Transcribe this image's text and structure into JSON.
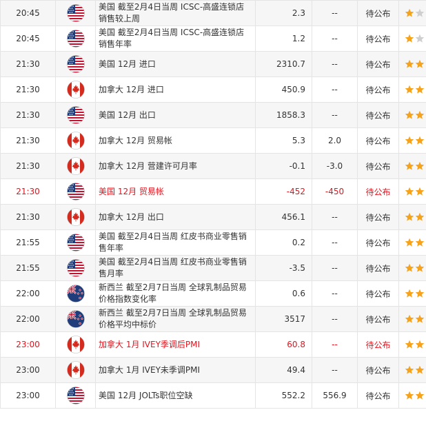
{
  "colors": {
    "highlight": "#e0141e",
    "star_on": "#f7a21b",
    "star_off": "#cfcfcf"
  },
  "rows": [
    {
      "time": "20:45",
      "country": "us",
      "event": "美国 截至2月4日当周 ICSC-高盛连锁店销售较上周",
      "previous": "2.3",
      "forecast": "--",
      "actual": "待公布",
      "stars": 1,
      "highlight": false
    },
    {
      "time": "20:45",
      "country": "us",
      "event": "美国 截至2月4日当周 ICSC-高盛连锁店销售年率",
      "previous": "1.2",
      "forecast": "--",
      "actual": "待公布",
      "stars": 1,
      "highlight": false
    },
    {
      "time": "21:30",
      "country": "us",
      "event": "美国 12月 进口",
      "previous": "2310.7",
      "forecast": "--",
      "actual": "待公布",
      "stars": 2,
      "highlight": false
    },
    {
      "time": "21:30",
      "country": "ca",
      "event": "加拿大 12月 进口",
      "previous": "450.9",
      "forecast": "--",
      "actual": "待公布",
      "stars": 2,
      "highlight": false
    },
    {
      "time": "21:30",
      "country": "us",
      "event": "美国 12月 出口",
      "previous": "1858.3",
      "forecast": "--",
      "actual": "待公布",
      "stars": 2,
      "highlight": false
    },
    {
      "time": "21:30",
      "country": "ca",
      "event": "加拿大 12月 贸易帐",
      "previous": "5.3",
      "forecast": "2.0",
      "actual": "待公布",
      "stars": 2,
      "highlight": false
    },
    {
      "time": "21:30",
      "country": "ca",
      "event": "加拿大 12月 营建许可月率",
      "previous": "-0.1",
      "forecast": "-3.0",
      "actual": "待公布",
      "stars": 2,
      "highlight": false
    },
    {
      "time": "21:30",
      "country": "us",
      "event": "美国 12月 贸易帐",
      "previous": "-452",
      "forecast": "-450",
      "actual": "待公布",
      "stars": 3,
      "highlight": true
    },
    {
      "time": "21:30",
      "country": "ca",
      "event": "加拿大 12月 出口",
      "previous": "456.1",
      "forecast": "--",
      "actual": "待公布",
      "stars": 2,
      "highlight": false
    },
    {
      "time": "21:55",
      "country": "us",
      "event": "美国 截至2月4日当周 红皮书商业零售销售年率",
      "previous": "0.2",
      "forecast": "--",
      "actual": "待公布",
      "stars": 2,
      "highlight": false
    },
    {
      "time": "21:55",
      "country": "us",
      "event": "美国 截至2月4日当周 红皮书商业零售销售月率",
      "previous": "-3.5",
      "forecast": "--",
      "actual": "待公布",
      "stars": 2,
      "highlight": false
    },
    {
      "time": "22:00",
      "country": "nz",
      "event": "新西兰 截至2月7日当周 全球乳制品贸易价格指数变化率",
      "previous": "0.6",
      "forecast": "--",
      "actual": "待公布",
      "stars": 2,
      "highlight": false
    },
    {
      "time": "22:00",
      "country": "nz",
      "event": "新西兰 截至2月7日当周 全球乳制品贸易价格平均中标价",
      "previous": "3517",
      "forecast": "--",
      "actual": "待公布",
      "stars": 2,
      "highlight": false
    },
    {
      "time": "23:00",
      "country": "ca",
      "event": "加拿大 1月 IVEY季调后PMI",
      "previous": "60.8",
      "forecast": "--",
      "actual": "待公布",
      "stars": 3,
      "highlight": true
    },
    {
      "time": "23:00",
      "country": "ca",
      "event": "加拿大 1月 IVEY未季调PMI",
      "previous": "49.4",
      "forecast": "--",
      "actual": "待公布",
      "stars": 2,
      "highlight": false
    },
    {
      "time": "23:00",
      "country": "us",
      "event": "美国 12月 JOLTs职位空缺",
      "previous": "552.2",
      "forecast": "556.9",
      "actual": "待公布",
      "stars": 2,
      "highlight": false
    }
  ]
}
